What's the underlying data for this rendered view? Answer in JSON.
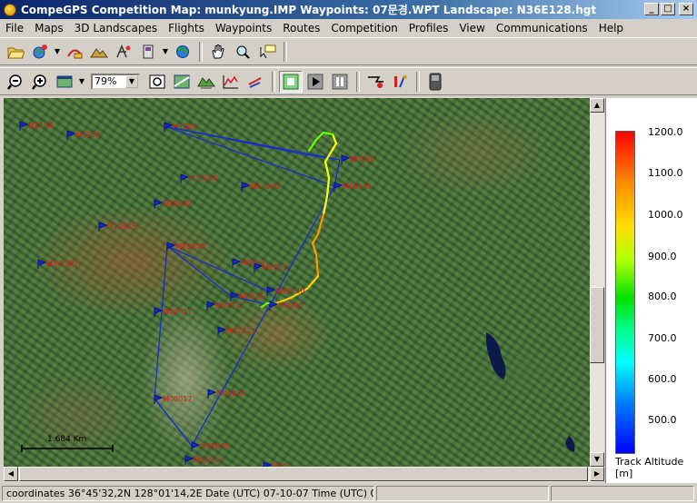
{
  "window": {
    "title": "CompeGPS Competition Map: munkyung.IMP Waypoints:  07문경.WPT Landscape: N36E128.hgt",
    "minimize": "_",
    "maximize": "□",
    "close": "×"
  },
  "menu": [
    "File",
    "Maps",
    "3D Landscapes",
    "Flights",
    "Waypoints",
    "Routes",
    "Competition",
    "Profiles",
    "View",
    "Communications",
    "Help"
  ],
  "toolbar": {
    "zoom_value": "79%",
    "icons_row1": [
      "open-folder-icon",
      "globe-pin-icon",
      "route-icon",
      "landscape-icon",
      "waypoint-tool-icon",
      "card-icon",
      "gps-globe-icon",
      "hand-pan-icon",
      "magnify-pointer-icon",
      "comment-pointer-icon"
    ],
    "icons_row2": [
      "zoom-out-icon",
      "zoom-in-icon",
      "map-view-icon",
      "zoom-fit-icon",
      "layers-icon",
      "3d-view-icon",
      "altitude-graph-icon",
      "speed-graph-icon",
      "stop-icon",
      "play-icon",
      "pause-icon",
      "record-icon",
      "thermal-icon",
      "gps-icon"
    ]
  },
  "map": {
    "scale_label": "1.684 Km",
    "track_colors": [
      "#ffff00",
      "#ff9900",
      "#ff3300",
      "#ffcc00",
      "#66ff00",
      "#00ff66",
      "#00ccff",
      "#0066ff",
      "#0000ff"
    ],
    "waypoints": [
      {
        "id": "M1104"
      },
      {
        "id": "M0000"
      },
      {
        "id": "M1104"
      },
      {
        "id": "M0530"
      },
      {
        "id": "M10030"
      },
      {
        "id": "M11020"
      },
      {
        "id": "M10231"
      },
      {
        "id": "M10042"
      },
      {
        "id": "M10025"
      },
      {
        "id": "M10039"
      },
      {
        "id": "M1 0512"
      },
      {
        "id": "M1052"
      },
      {
        "id": "M1052"
      },
      {
        "id": "M10010"
      },
      {
        "id": "M0028"
      },
      {
        "id": "M10017"
      },
      {
        "id": "M02017"
      },
      {
        "id": "M0000"
      },
      {
        "id": "M02015"
      },
      {
        "id": "M00017"
      },
      {
        "id": "M00020"
      },
      {
        "id": "M01015"
      },
      {
        "id": "M02012"
      },
      {
        "id": "M00"
      }
    ]
  },
  "legend": {
    "ticks": [
      "1200.0",
      "1100.0",
      "1000.0",
      "900.0",
      "800.0",
      "700.0",
      "600.0",
      "500.0"
    ],
    "title_line1": "Track Altitude",
    "title_line2": "[m]"
  },
  "status": {
    "coordinates": "coordinates 36°45'32,2N 128°01'14,2E Date (UTC) 07-10-07 Time (UTC) 0",
    "pane2": "",
    "pane3": ""
  }
}
